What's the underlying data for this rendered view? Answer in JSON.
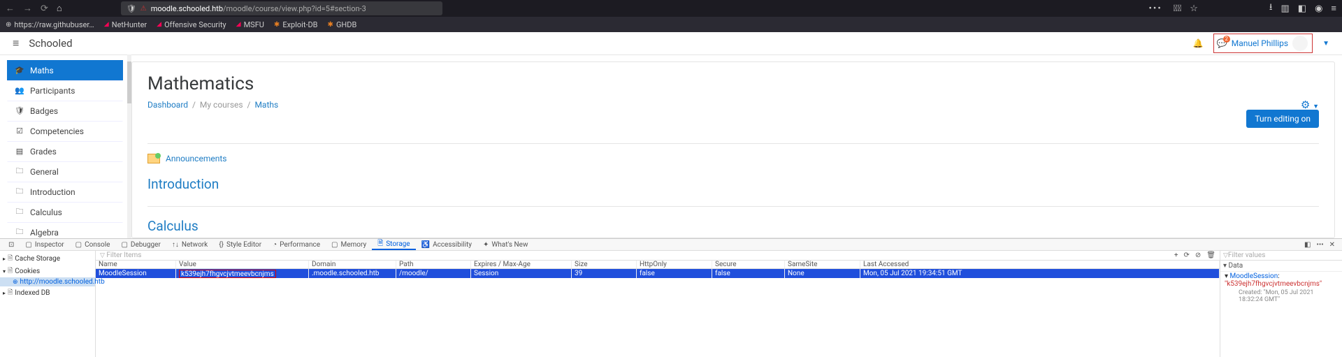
{
  "browser": {
    "url_host": "moodle.schooled.htb",
    "url_path": "/moodle/course/view.php?id=5#section-3"
  },
  "bookmarks": [
    {
      "icon": "globe",
      "label": "https://raw.githubuser…"
    },
    {
      "icon": "kali",
      "label": "NetHunter"
    },
    {
      "icon": "kali",
      "label": "Offensive Security"
    },
    {
      "icon": "kali",
      "label": "MSFU"
    },
    {
      "icon": "orange",
      "label": "Exploit-DB"
    },
    {
      "icon": "orange",
      "label": "GHDB"
    }
  ],
  "moodle": {
    "brand": "Schooled",
    "notif_badge": "2",
    "username": "Manuel Phillips"
  },
  "sidebar": {
    "items": [
      {
        "icon": "🎓",
        "label": "Maths",
        "active": true
      },
      {
        "icon": "👥",
        "label": "Participants"
      },
      {
        "icon": "🛡",
        "label": "Badges"
      },
      {
        "icon": "☑",
        "label": "Competencies"
      },
      {
        "icon": "▤",
        "label": "Grades"
      },
      {
        "icon": "🗀",
        "label": "General"
      },
      {
        "icon": "🗀",
        "label": "Introduction"
      },
      {
        "icon": "🗀",
        "label": "Calculus"
      },
      {
        "icon": "🗀",
        "label": "Algebra"
      }
    ]
  },
  "course": {
    "title": "Mathematics",
    "breadcrumb": {
      "dash": "Dashboard",
      "my": "My courses",
      "current": "Maths"
    },
    "edit_btn": "Turn editing on",
    "announcements": "Announcements",
    "sections": [
      "Introduction",
      "Calculus"
    ]
  },
  "devtools": {
    "tabs": [
      "Inspector",
      "Console",
      "Debugger",
      "Network",
      "Style Editor",
      "Performance",
      "Memory",
      "Storage",
      "Accessibility",
      "What's New"
    ],
    "active_tab": "Storage",
    "tree": {
      "cache": "Cache Storage",
      "cookies": "Cookies",
      "cookie_host": "http://moodle.schooled.htb",
      "idb": "Indexed DB"
    },
    "filter_placeholder": "Filter Items",
    "cols": [
      "Name",
      "Value",
      "Domain",
      "Path",
      "Expires / Max-Age",
      "Size",
      "HttpOnly",
      "Secure",
      "SameSite",
      "Last Accessed"
    ],
    "row": {
      "name": "MoodleSession",
      "value": "k539ejh7fhgvcjvtmeevbcnjms",
      "domain": ".moodle.schooled.htb",
      "path": "/moodle/",
      "expires": "Session",
      "size": "39",
      "httponly": "false",
      "secure": "false",
      "samesite": "None",
      "last": "Mon, 05 Jul 2021 19:34:51 GMT"
    },
    "data_panel": {
      "filter": "Filter values",
      "header": "▾ Data",
      "key": "MoodleSession",
      "val": "\"k539ejh7fhgvcjvtmeevbcnjms\"",
      "created": "Created: \"Mon, 05 Jul 2021 18:32:24 GMT\""
    }
  }
}
